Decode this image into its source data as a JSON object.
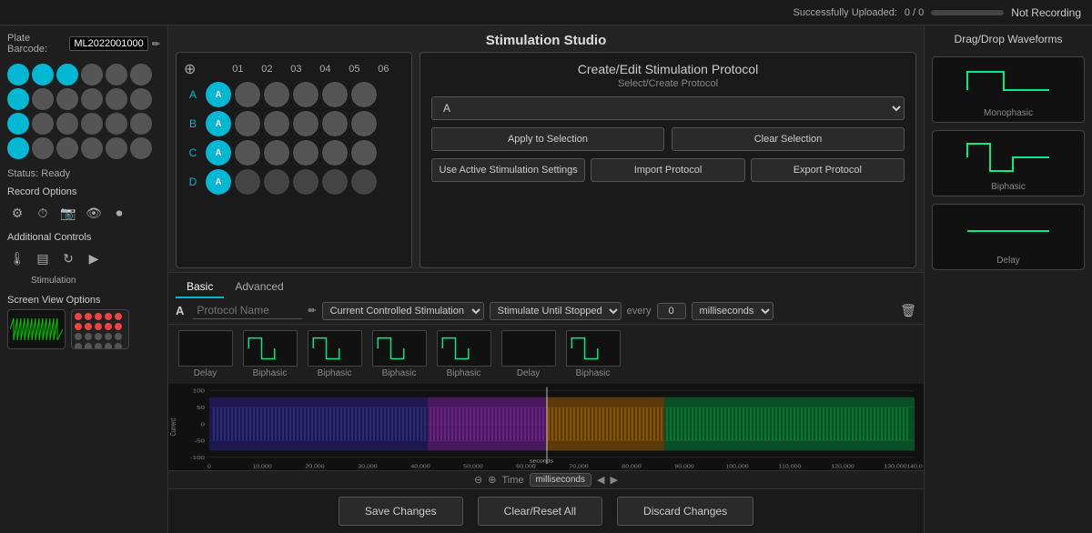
{
  "topBar": {
    "uploadLabel": "Successfully Uploaded:",
    "uploadCount": "0 / 0",
    "recordingStatus": "Not Recording"
  },
  "leftPanel": {
    "plateBarcodeLabel": "Plate Barcode:",
    "plateBarcodeValue": "ML2022001000",
    "statusLabel": "Status: Ready",
    "recordOptionsLabel": "Record Options",
    "additionalControlsLabel": "Additional Controls",
    "stimulationSubLabel": "Stimulation",
    "screenViewLabel": "Screen View Options"
  },
  "center": {
    "title": "Stimulation Studio",
    "tabs": [
      "Basic",
      "Advanced"
    ],
    "activeTab": "Basic",
    "protocolPanel": {
      "title": "Create/Edit Stimulation Protocol",
      "subtitle": "Select/Create Protocol",
      "selectValue": "A",
      "applyBtn": "Apply to Selection",
      "clearBtn": "Clear Selection",
      "useActiveBtn": "Use Active Stimulation Settings",
      "importBtn": "Import Protocol",
      "exportBtn": "Export Protocol"
    },
    "protocolRow": {
      "badge": "A",
      "namePlaceholder": "Protocol Name",
      "stimType": "Current Controlled Stimulation ▼",
      "stimUntil": "Stimulate Until Stopped ▼",
      "everyLabel": "every",
      "everyValue": "0",
      "everyUnit": "milliseconds ▼"
    },
    "waveformBlocks": [
      {
        "label": "Delay"
      },
      {
        "label": "Biphasic"
      },
      {
        "label": "Biphasic"
      },
      {
        "label": "Biphasic"
      },
      {
        "label": "Biphasic"
      },
      {
        "label": "Delay"
      },
      {
        "label": "Biphasic"
      }
    ],
    "chart": {
      "yLabel": "Current",
      "xLabel": "Time",
      "yMax": 100,
      "yMid": 50,
      "y0": 0,
      "yNeg50": -50,
      "yMin": -100,
      "xTicks": [
        "0",
        "10,000",
        "20,000",
        "30,000",
        "40,000",
        "50,000",
        "60,000",
        "seconds",
        "70,000",
        "80,000",
        "90,000",
        "100,000",
        "110,000",
        "120,000",
        "130,000",
        "140,0"
      ],
      "unitToggle": "milliseconds"
    },
    "bottomButtons": {
      "save": "Save Changes",
      "clear": "Clear/Reset All",
      "discard": "Discard Changes"
    }
  },
  "rightPanel": {
    "title": "Drag/Drop Waveforms",
    "waveforms": [
      {
        "label": "Monophasic"
      },
      {
        "label": "Biphasic"
      },
      {
        "label": "Delay"
      }
    ]
  },
  "wellGrid": {
    "colLabels": [
      "01",
      "02",
      "03",
      "04",
      "05",
      "06"
    ],
    "rows": [
      {
        "label": "A",
        "active": true,
        "wells": [
          true,
          false,
          false,
          false,
          false,
          false
        ]
      },
      {
        "label": "B",
        "active": true,
        "wells": [
          true,
          false,
          false,
          false,
          false,
          false
        ]
      },
      {
        "label": "C",
        "active": true,
        "wells": [
          true,
          false,
          false,
          false,
          false,
          false
        ]
      },
      {
        "label": "D",
        "active": true,
        "wells": [
          true,
          true,
          true,
          true,
          true,
          true
        ]
      }
    ]
  }
}
